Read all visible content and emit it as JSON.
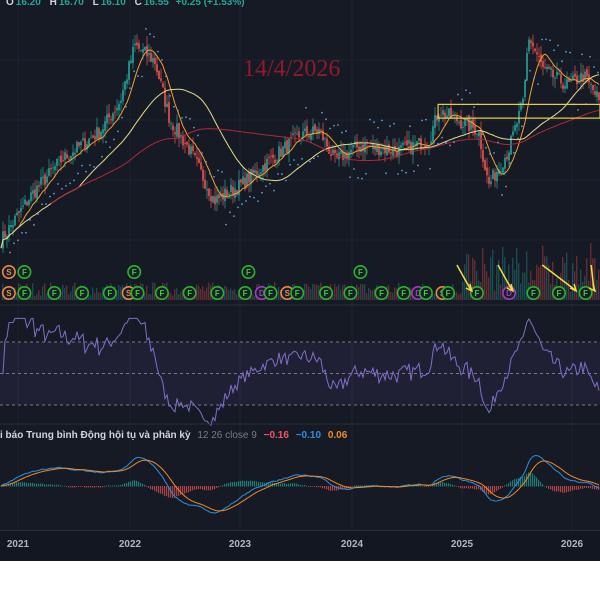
{
  "legend": {
    "o_label": "O",
    "o": "16.20",
    "h_label": "H",
    "h": "16.70",
    "l_label": "L",
    "l": "16.10",
    "c_label": "C",
    "c": "16.55",
    "change": "+0.25 (+1.53%)"
  },
  "annotation": "14/4/2026",
  "macd_legend": {
    "title": "i báo Trung bình Động hội tụ và phân kỳ",
    "params": "12 26 close 9",
    "macd": "−0.16",
    "signal": "−0.10",
    "hist": "0.06"
  },
  "colors": {
    "up": "#26a69a",
    "down": "#ef5350",
    "ma_fast": "#f0a030",
    "ma_slow": "#e8dc8a",
    "ma_long": "#b02838",
    "sar": "#5b9bd5",
    "rsi": "#7e6fc7",
    "macd": "#2d8fe0",
    "signal": "#f08a24",
    "box": "#e6d34a"
  },
  "chart_data": {
    "type": "candlestick",
    "title": "",
    "x_ticks": [
      "2021",
      "2022",
      "2023",
      "2024",
      "2025",
      "2026"
    ],
    "x_range": [
      2020.84,
      2026.25
    ],
    "price_anchors": [
      [
        2020.84,
        5.3
      ],
      [
        2021.11,
        8.9
      ],
      [
        2021.38,
        11.7
      ],
      [
        2021.74,
        14.1
      ],
      [
        2021.92,
        16.5
      ],
      [
        2022.05,
        20.9
      ],
      [
        2022.23,
        19.7
      ],
      [
        2022.37,
        14.9
      ],
      [
        2022.55,
        12.5
      ],
      [
        2022.77,
        8.5
      ],
      [
        2023.0,
        9.7
      ],
      [
        2023.27,
        11.7
      ],
      [
        2023.54,
        13.7
      ],
      [
        2023.72,
        14.1
      ],
      [
        2023.86,
        11.7
      ],
      [
        2024.08,
        12.9
      ],
      [
        2024.44,
        12.5
      ],
      [
        2024.71,
        13.3
      ],
      [
        2024.8,
        15.7
      ],
      [
        2025.16,
        14.1
      ],
      [
        2025.25,
        9.7
      ],
      [
        2025.43,
        12.5
      ],
      [
        2025.57,
        16.5
      ],
      [
        2025.61,
        21.7
      ],
      [
        2025.75,
        18.9
      ],
      [
        2025.97,
        17.7
      ],
      [
        2026.11,
        18.5
      ],
      [
        2026.25,
        16.55
      ]
    ],
    "last_close": 16.55,
    "indicators": [
      "SMA fast",
      "SMA slow",
      "SMA long",
      "Parabolic SAR",
      "Volume",
      "RSI 14",
      "MACD 12 26 close 9"
    ],
    "rsi_bands": [
      70,
      50,
      30
    ],
    "macd_values": {
      "macd": -0.16,
      "signal": -0.1,
      "hist": 0.06
    },
    "signals_top": [
      [
        "S",
        2020.92
      ],
      [
        "F",
        2021.06
      ],
      [
        "F",
        2022.05
      ],
      [
        "F",
        2023.08
      ],
      [
        "F",
        2024.09
      ]
    ],
    "signals_bottom": [
      [
        "S",
        2020.92
      ],
      [
        "F",
        2021.06
      ],
      [
        "F",
        2021.33
      ],
      [
        "F",
        2021.58
      ],
      [
        "F",
        2021.83
      ],
      [
        "S",
        2022.0
      ],
      [
        "F",
        2022.08
      ],
      [
        "F",
        2022.3
      ],
      [
        "F",
        2022.55
      ],
      [
        "F",
        2022.8
      ],
      [
        "F",
        2023.05
      ],
      [
        "D",
        2023.2
      ],
      [
        "F",
        2023.28
      ],
      [
        "S",
        2023.43
      ],
      [
        "F",
        2023.52
      ],
      [
        "F",
        2023.78
      ],
      [
        "F",
        2024.0
      ],
      [
        "F",
        2024.28
      ],
      [
        "F",
        2024.48
      ],
      [
        "D",
        2024.61
      ],
      [
        "F",
        2024.68
      ],
      [
        "S",
        2024.83
      ],
      [
        "F",
        2024.88
      ],
      [
        "F",
        2025.14
      ],
      [
        "D",
        2025.43
      ],
      [
        "F",
        2025.65
      ],
      [
        "F",
        2025.88
      ],
      [
        "F",
        2026.12
      ]
    ],
    "arrows": [
      [
        2024.96,
        2025.14
      ],
      [
        2025.33,
        2025.51
      ],
      [
        2025.73,
        2026.08
      ],
      [
        2026.17,
        2026.25
      ]
    ],
    "box_range": [
      15.1,
      16.2
    ],
    "box_x": [
      2024.79,
      2026.25
    ]
  }
}
